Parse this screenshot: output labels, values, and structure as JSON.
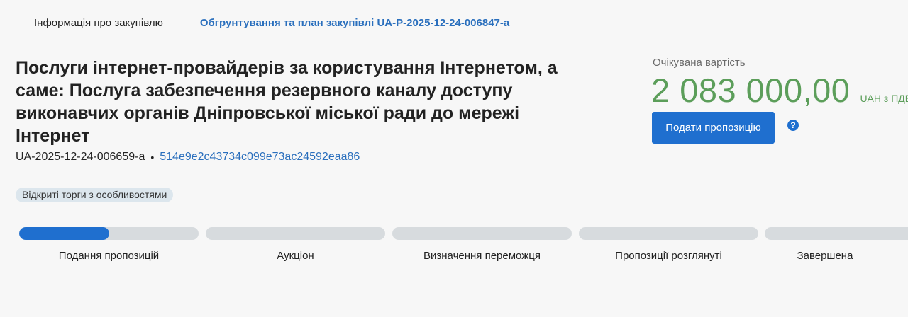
{
  "tabs": {
    "info_label": "Інформація про закупівлю",
    "plan_label": "Обгрунтування та план закупівлі UA-P-2025-12-24-006847-a"
  },
  "tender": {
    "title": "Послуги інтернет-провайдерів за користування Інтернетом, а саме: Послуга забезпечення резервного каналу доступу виконавчих органів Дніпровської міської ради до мережі Інтернет",
    "id": "UA-2025-12-24-006659-a",
    "separator": "•",
    "hash": "514e9e2c43734c099e73ac24592eaa86",
    "procedure_badge": "Відкриті торги з особливостями"
  },
  "price": {
    "label": "Очікувана вартість",
    "amount": "2 083 000,00",
    "currency": "UAH з ПДВ"
  },
  "actions": {
    "submit_label": "Подати пропозицію",
    "help_icon": "question-circle-icon",
    "help_glyph": "?"
  },
  "stages": [
    {
      "label": "Подання пропозицій",
      "progress": 0.5
    },
    {
      "label": "Аукціон",
      "progress": 0
    },
    {
      "label": "Визначення переможця",
      "progress": 0
    },
    {
      "label": "Пропозиції розглянуті",
      "progress": 0
    },
    {
      "label": "Завершена",
      "progress": 0
    }
  ],
  "colors": {
    "accent": "#1f6fcf",
    "price": "#5c9e5a",
    "link": "#2a6fbd",
    "track": "#d7dbde"
  }
}
